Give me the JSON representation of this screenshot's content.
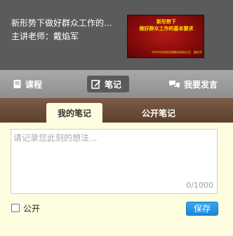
{
  "header": {
    "course_title": "新形势下做好群众工作的...",
    "teacher": "主讲老师：戴焰军",
    "thumbnail": {
      "line1": "新形势下",
      "line2": "做好群众工作的基本要求",
      "footer": "中共中央党校党建教研部副主任　戴焰军"
    }
  },
  "toolbar": {
    "course_label": "课程",
    "notes_label": "笔记",
    "speak_label": "我要发言"
  },
  "tabs": {
    "mine": "我的笔记",
    "public": "公开笔记"
  },
  "editor": {
    "placeholder": "请记录您此刻的想法...",
    "value": "",
    "counter": "0/1000"
  },
  "public_checkbox": {
    "label": "公开",
    "checked": false
  },
  "save_label": "保存",
  "colors": {
    "header_bg": "#5b5b5b",
    "toolbar_bg": "#999999",
    "tabs_bg": "#6e503b",
    "content_bg": "#fffde0",
    "save_button": "#2196e6",
    "thumbnail_red": "#9e1410",
    "thumbnail_text": "#ffe400"
  },
  "icons": {
    "course": "book-icon",
    "notes": "edit-icon",
    "speak": "chat-bubbles-icon"
  }
}
